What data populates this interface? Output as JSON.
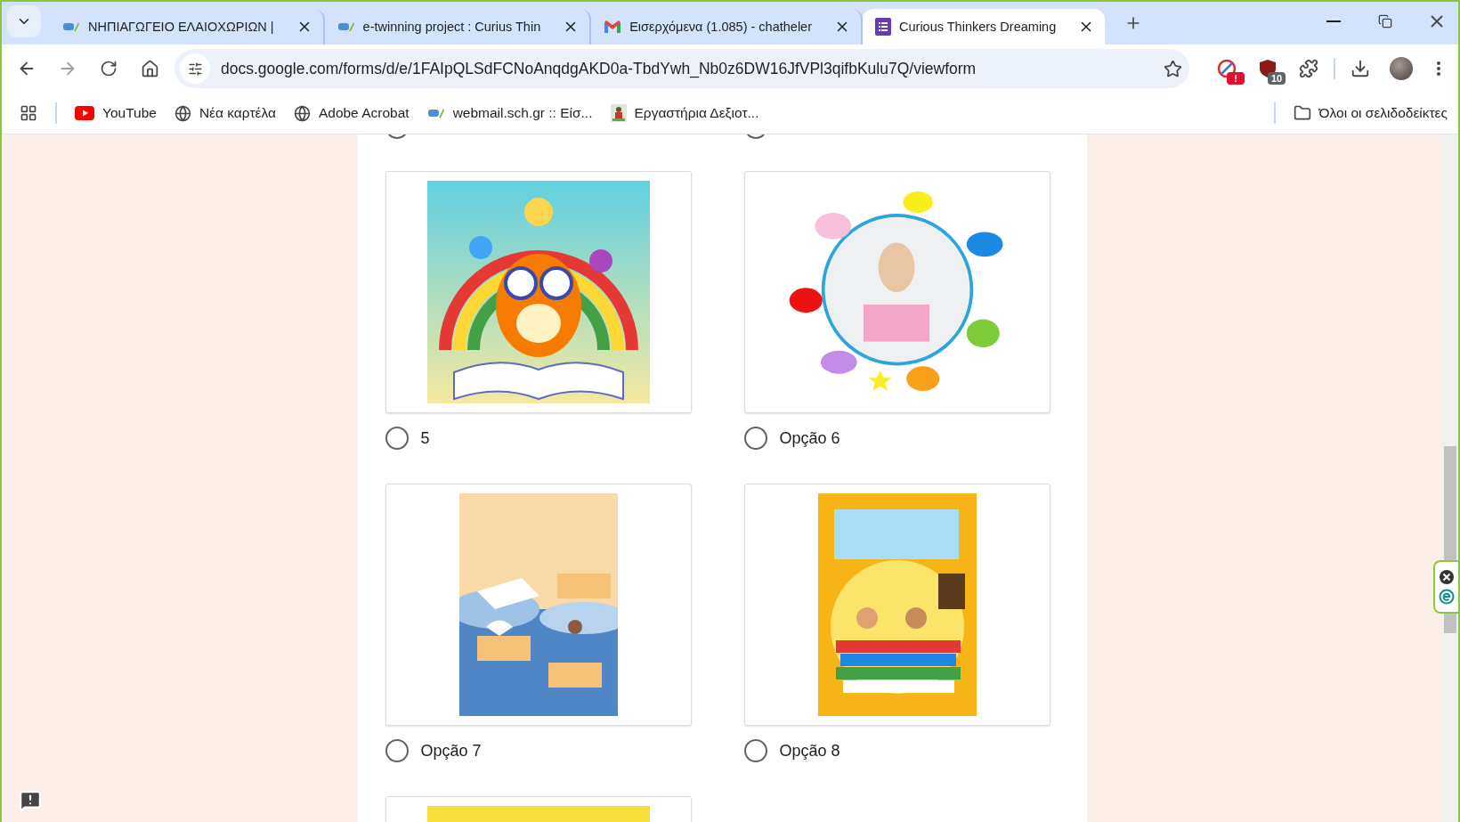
{
  "tabs": [
    {
      "label": "ΝΗΠΙΑΓΩΓΕΙΟ ΕΛΑΙΟΧΩΡΙΩΝ |",
      "selected": false
    },
    {
      "label": "e-twinning project : Curius Thin",
      "selected": false
    },
    {
      "label": "Εισερχόμενα (1.085) - chatheler",
      "selected": false
    },
    {
      "label": "Curious Thinkers Dreaming",
      "selected": true
    }
  ],
  "address_bar": {
    "url": "docs.google.com/forms/d/e/1FAIpQLSdFCNoAnqdgAKD0a-TbdYwh_Nb0z6DW16JfVPl3qifbKulu7Q/viewform"
  },
  "extension_badges": [
    "!",
    "10"
  ],
  "bookmarks": [
    "YouTube",
    "Νέα καρτέλα",
    "Adobe Acrobat",
    "webmail.sch.gr :: Είσ...",
    "Εργαστήρια Δεξιοτ..."
  ],
  "all_bookmarks": "Όλοι οι σελιδοδείκτες",
  "previous_row": [
    {
      "selected": false
    },
    {
      "selected": false
    }
  ],
  "options": [
    {
      "label": "5",
      "selected": false
    },
    {
      "label": "Opção 6",
      "selected": false
    },
    {
      "label": "Opção 7",
      "selected": false
    },
    {
      "label": "Opção 8",
      "selected": false
    }
  ]
}
